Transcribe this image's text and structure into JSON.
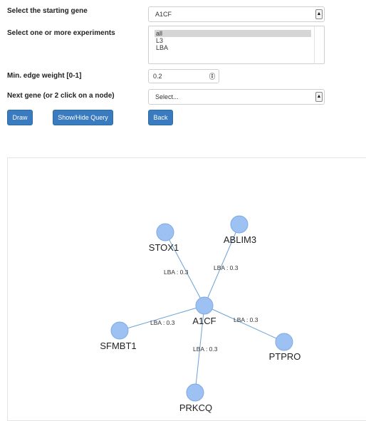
{
  "form": {
    "start_gene_label": "Select the starting gene",
    "start_gene_value": "A1CF",
    "experiments_label": "Select one or more experiments",
    "experiments_options": [
      "all",
      "L3",
      "LBA"
    ],
    "experiments_selected": "all",
    "min_edge_label": "Min. edge weight [0-1]",
    "min_edge_value": "0.2",
    "next_gene_label": "Next gene (or 2 click on a node)",
    "next_gene_value": "Select..."
  },
  "buttons": {
    "draw": "Draw",
    "show_hide": "Show/Hide Query",
    "back": "Back"
  },
  "graph": {
    "node_color": "#9ec1f3",
    "edge_color": "#6aa0d8",
    "nodes": {
      "center": "A1CF",
      "stox1": "STOX1",
      "ablim3": "ABLIM3",
      "sfmbt1": "SFMBT1",
      "ptpro": "PTPRO",
      "prkcq": "PRKCQ"
    },
    "edges": {
      "stox1": "LBA : 0.3",
      "ablim3": "LBA : 0.3",
      "sfmbt1": "LBA : 0.3",
      "ptpro": "LBA : 0.3",
      "prkcq": "LBA : 0.3"
    }
  }
}
